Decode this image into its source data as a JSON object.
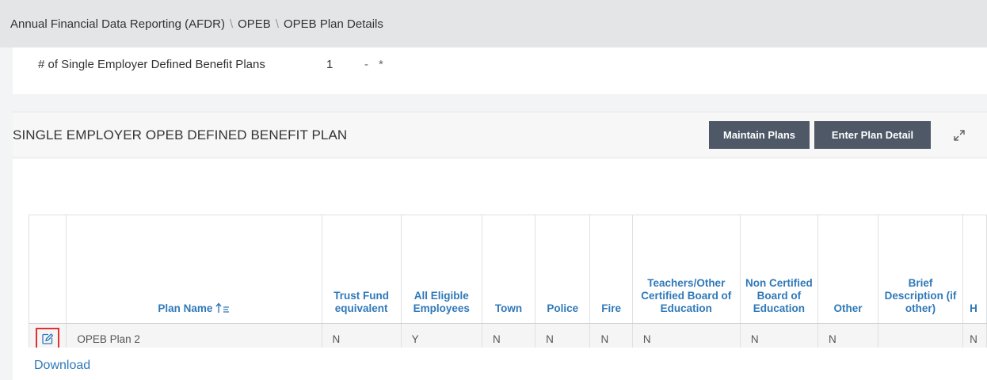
{
  "breadcrumb": [
    "Annual Financial Data Reporting (AFDR)",
    "OPEB",
    "OPEB Plan Details"
  ],
  "summary": {
    "label": "# of Single Employer Defined Benefit Plans",
    "value": "1",
    "dash": "-",
    "star": "*"
  },
  "panel": {
    "title": "SINGLE EMPLOYER OPEB DEFINED BENEFIT PLAN",
    "maintain_label": "Maintain Plans",
    "enter_label": "Enter Plan Detail"
  },
  "table": {
    "headers": {
      "plan_name": "Plan Name",
      "trust": "Trust Fund equivalent",
      "all_eligible": "All Eligible Employees",
      "town": "Town",
      "police": "Police",
      "fire": "Fire",
      "teachers": "Teachers/Other Certified Board of Education",
      "non_certified": "Non Certified Board of Education",
      "other": "Other",
      "brief": "Brief Description (if other)",
      "next": "H"
    },
    "rows": [
      {
        "plan_name": "OPEB Plan 2",
        "trust": "N",
        "all_eligible": "Y",
        "town": "N",
        "police": "N",
        "fire": "N",
        "teachers": "N",
        "non_certified": "N",
        "other": "N",
        "brief": "",
        "next": "N"
      }
    ]
  },
  "download_label": "Download",
  "colors": {
    "header_blue": "#2f79b9",
    "button_bg": "#4e5866",
    "highlight_red": "#e0302f"
  }
}
